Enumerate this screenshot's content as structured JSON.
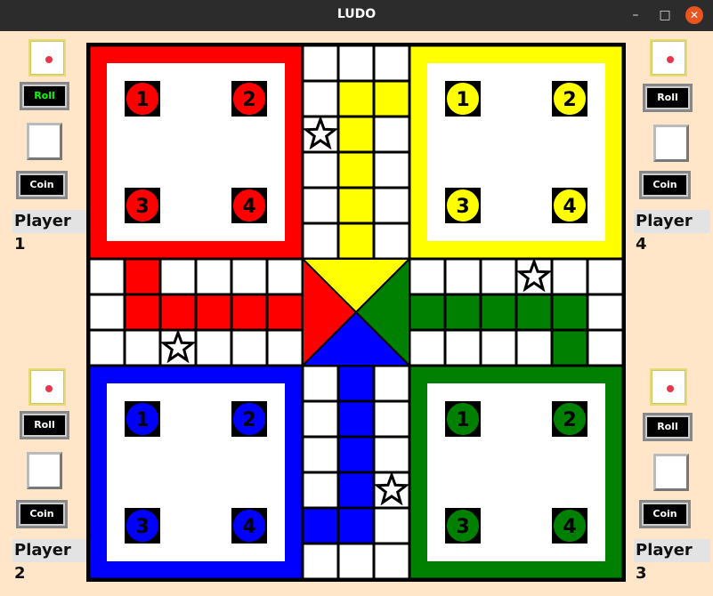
{
  "window": {
    "title": "LUDO"
  },
  "players": [
    {
      "id": "p1",
      "label": "Player 1",
      "roll_label": "Roll",
      "coin_label": "Coin",
      "roll_active": true
    },
    {
      "id": "p4",
      "label": "Player 4",
      "roll_label": "Roll",
      "coin_label": "Coin",
      "roll_active": false
    },
    {
      "id": "p2",
      "label": "Player 2",
      "roll_label": "Roll",
      "coin_label": "Coin",
      "roll_active": false
    },
    {
      "id": "p3",
      "label": "Player 3",
      "roll_label": "Roll",
      "coin_label": "Coin",
      "roll_active": false
    }
  ],
  "colors": {
    "red": "#ff0000",
    "yellow": "#ffff00",
    "blue": "#0000ff",
    "green": "#008000",
    "background": "#ffe6c8",
    "active_roll_text": "#00ff00"
  },
  "homes": [
    {
      "color": "red",
      "tokens": [
        "1",
        "2",
        "3",
        "4"
      ]
    },
    {
      "color": "yellow",
      "tokens": [
        "1",
        "2",
        "3",
        "4"
      ]
    },
    {
      "color": "blue",
      "tokens": [
        "1",
        "2",
        "3",
        "4"
      ]
    },
    {
      "color": "green",
      "tokens": [
        "1",
        "2",
        "3",
        "4"
      ]
    }
  ]
}
